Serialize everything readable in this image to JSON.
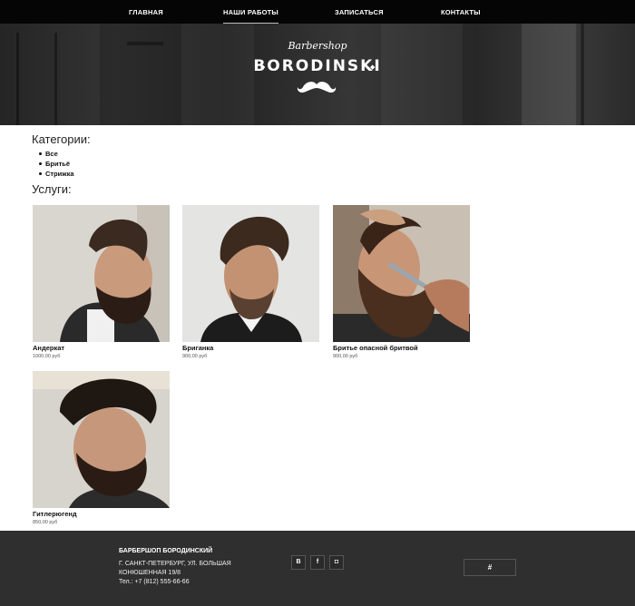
{
  "nav": {
    "items": [
      {
        "label": "ГЛАВНАЯ"
      },
      {
        "label": "НАШИ РАБОТЫ"
      },
      {
        "label": "ЗАПИСАТЬСЯ"
      },
      {
        "label": "КОНТАКТЫ"
      }
    ],
    "active_index": 1
  },
  "hero": {
    "script_text": "Barbershop",
    "brand_text": "BORODINSKI",
    "logo_icon": "mustache-icon"
  },
  "categories": {
    "heading": "Категории:",
    "items": [
      "Все",
      "Бритьё",
      "Стрижка"
    ]
  },
  "services": {
    "heading": "Услуги:",
    "items": [
      {
        "name": "Андеркат",
        "price": "1000,00 руб"
      },
      {
        "name": "Бриганка",
        "price": "900,00 руб"
      },
      {
        "name": "Бритье опасной бритвой",
        "price": "900,00 руб"
      },
      {
        "name": "Гитлерюгенд",
        "price": "850,00 руб"
      }
    ]
  },
  "footer": {
    "title": "БАРБЕРШОП БОРОДИНСКИЙ",
    "address_line1": "Г. САНКТ-ПЕТЕРБУРГ, УЛ. БОЛЬШАЯ",
    "address_line2": "КОНЮШЕННАЯ 19/8",
    "phone": "Тел.: +7 (812) 555-66-66",
    "social": [
      {
        "label": "B",
        "icon": "vk-icon"
      },
      {
        "label": "f",
        "icon": "facebook-icon"
      },
      {
        "label": "◘",
        "icon": "instagram-icon"
      }
    ],
    "button_label": "#"
  },
  "colors": {
    "nav_bg": "#050505",
    "footer_bg": "#2f2f2f",
    "text": "#222222"
  }
}
